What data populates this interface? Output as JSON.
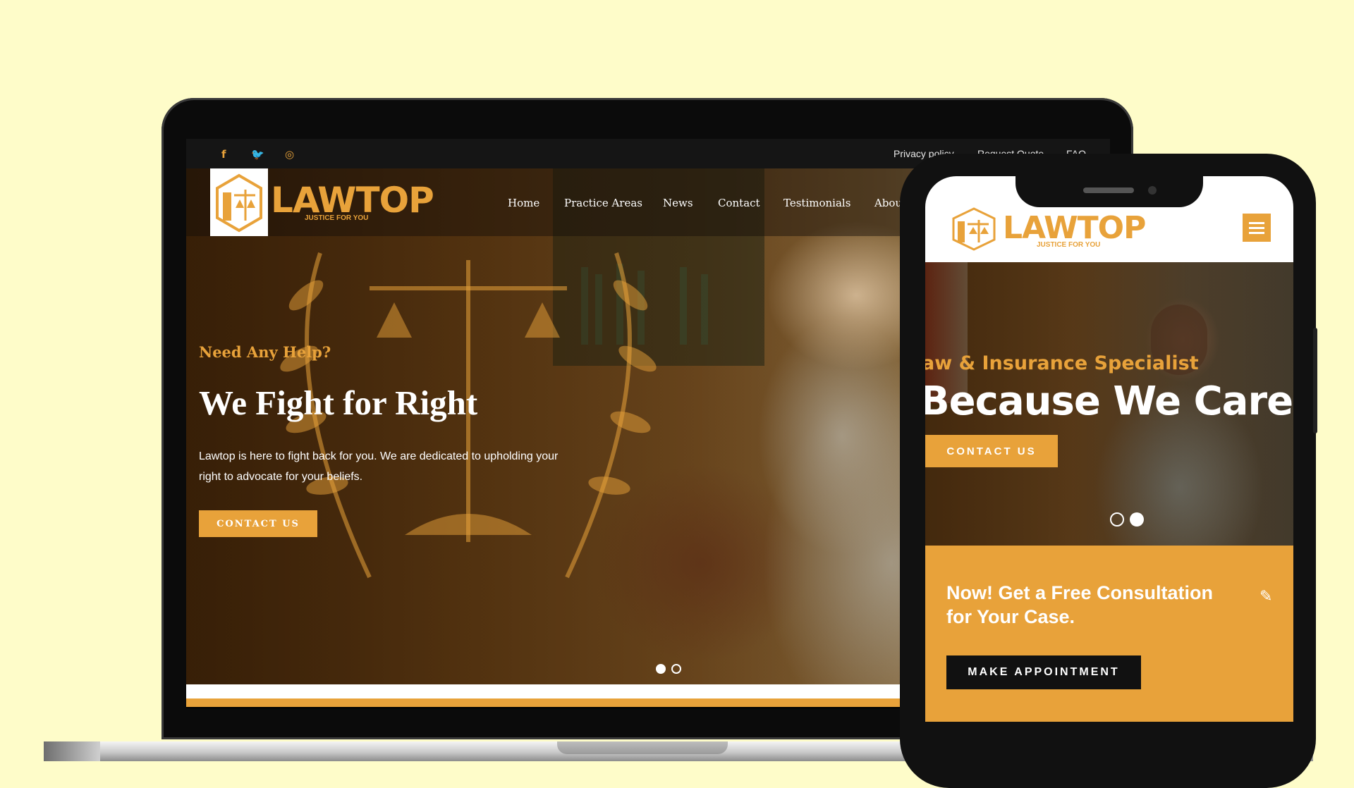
{
  "colors": {
    "accent": "#e8a23a",
    "background": "#fefcc9",
    "dark": "#111111"
  },
  "desktop": {
    "social_icons": [
      "facebook-icon",
      "twitter-icon",
      "instagram-icon"
    ],
    "social_glyphs": {
      "facebook": "f",
      "twitter": "🐦",
      "instagram": "◎"
    },
    "top_links": [
      "Privacy policy",
      "Request Quote",
      "FAQ"
    ],
    "logo": {
      "name": "LAWTOP",
      "tagline": "JUSTICE FOR YOU"
    },
    "nav": [
      "Home",
      "Practice Areas",
      "News",
      "Contact",
      "Testimonials",
      "About"
    ],
    "hero": {
      "eyebrow": "Need Any Help?",
      "title": "We Fight for Right",
      "description": "Lawtop is here to fight back for you. We are dedicated to upholding your right to advocate for your beliefs.",
      "button": "CONTACT US",
      "slides": 2,
      "active_slide": 1
    }
  },
  "mobile": {
    "logo": {
      "name": "LAWTOP",
      "tagline": "JUSTICE FOR YOU"
    },
    "menu_icon": "hamburger-icon",
    "hero": {
      "eyebrow": "aw & Insurance Specialist",
      "title": "Because We Care",
      "button": "CONTACT US",
      "slides": 2,
      "active_slide": 2
    },
    "cta": {
      "text": "Now! Get a Free Consultation for Your Case.",
      "icon": "pen-icon",
      "button": "MAKE APPOINTMENT"
    }
  }
}
